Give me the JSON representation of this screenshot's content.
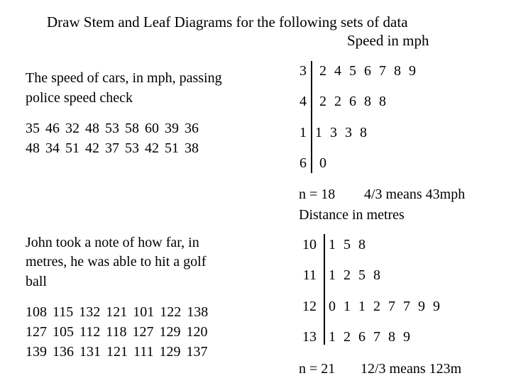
{
  "title": "Draw Stem and Leaf Diagrams for the following sets of data",
  "subtitle_speed": "Speed in mph",
  "speed": {
    "description_lines": [
      "The speed of cars, in mph, passing",
      "police speed check"
    ],
    "data_lines": [
      "35  46  32  48  53  58  60  39  36",
      "48  34  51  42  37  53  42  51  38"
    ],
    "rows": [
      {
        "stem": "3",
        "leaves": "2 4 5 6 7 8 9"
      },
      {
        "stem": "4",
        "leaves": "2 2 6 8 8"
      },
      {
        "stem": "1",
        "leaves": "1 3 3 8"
      },
      {
        "stem": "6",
        "leaves": "0"
      }
    ],
    "n_label": "n = 18",
    "key": "4/3 means 43mph"
  },
  "distance": {
    "heading": "Distance in metres",
    "description_lines": [
      "John took a note of how far, in",
      "metres,  he was able to hit a golf",
      "ball"
    ],
    "data_lines": [
      "108  115  132  121  101  122  138",
      "127  105  112  118  127  129  120",
      "139  136  131  121  111  129  137"
    ],
    "rows": [
      {
        "stem": "10",
        "leaves": "1 5 8"
      },
      {
        "stem": "11",
        "leaves": "1 2 5  8"
      },
      {
        "stem": "12",
        "leaves": "0 1 1 2 7 7 9 9"
      },
      {
        "stem": "13",
        "leaves": "1 2 6 7 8 9"
      }
    ],
    "n_label": "n = 21",
    "key": "12/3 means 123m"
  }
}
